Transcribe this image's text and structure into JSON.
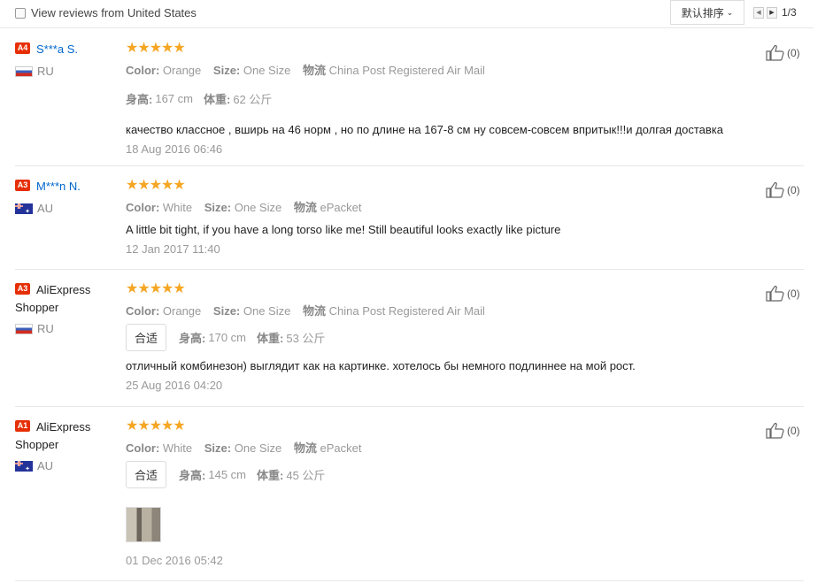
{
  "filter": {
    "label": "View reviews from United States"
  },
  "sort": {
    "label": "默认排序"
  },
  "pager": {
    "text": "1/3"
  },
  "reviews": [
    {
      "badge": "A4",
      "name": "S***a S.",
      "country": "RU",
      "flag": "ru",
      "stars": 5,
      "color_label": "Color:",
      "color": "Orange",
      "size_label": "Size:",
      "size": "One Size",
      "ship_label": "物流",
      "ship": "China Post Registered Air Mail",
      "height_label": "身高:",
      "height": "167 cm",
      "weight_label": "体重:",
      "weight": "62 公斤",
      "comment": "качество классное , вширь на 46 норм , но по длине на 167-8 см ну совсем-совсем впритык!!!и долгая доставка",
      "date": "18 Aug 2016 06:46",
      "helpful": "(0)"
    },
    {
      "badge": "A3",
      "name": "M***n N.",
      "country": "AU",
      "flag": "au",
      "stars": 5,
      "color_label": "Color:",
      "color": "White",
      "size_label": "Size:",
      "size": "One Size",
      "ship_label": "物流",
      "ship": "ePacket",
      "comment": "A little bit tight, if you have a long torso like me! Still beautiful looks exactly like picture",
      "date": "12 Jan 2017 11:40",
      "helpful": "(0)"
    },
    {
      "badge": "A3",
      "name_line1": "AliExpress",
      "name_line2": "Shopper",
      "country": "RU",
      "flag": "ru",
      "stars": 5,
      "color_label": "Color:",
      "color": "Orange",
      "size_label": "Size:",
      "size": "One Size",
      "ship_label": "物流",
      "ship": "China Post Registered Air Mail",
      "fit_tag": "合适",
      "height_label": "身高:",
      "height": "170 cm",
      "weight_label": "体重:",
      "weight": "53 公斤",
      "comment": "отличный комбинезон) выглядит как на картинке. хотелось бы немного подлиннее на мой рост.",
      "date": "25 Aug 2016 04:20",
      "helpful": "(0)"
    },
    {
      "badge": "A1",
      "name_line1": "AliExpress",
      "name_line2": "Shopper",
      "country": "AU",
      "flag": "au",
      "stars": 5,
      "color_label": "Color:",
      "color": "White",
      "size_label": "Size:",
      "size": "One Size",
      "ship_label": "物流",
      "ship": "ePacket",
      "fit_tag": "合适",
      "height_label": "身高:",
      "height": "145 cm",
      "weight_label": "体重:",
      "weight": "45 公斤",
      "date": "01 Dec 2016 05:42",
      "helpful": "(0)"
    }
  ],
  "icons": {
    "star": "star-icon",
    "thumb": "thumbs-up-icon",
    "prev": "prev-arrow-icon",
    "next": "next-arrow-icon"
  }
}
